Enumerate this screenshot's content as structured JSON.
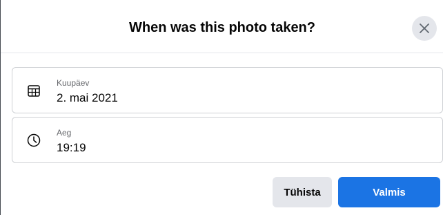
{
  "dialog": {
    "title": "When was this photo taken?",
    "close_icon": "close-icon"
  },
  "fields": {
    "date": {
      "label": "Kuupäev",
      "value": "2. mai 2021",
      "icon": "calendar-icon"
    },
    "time": {
      "label": "Aeg",
      "value": "19:19",
      "icon": "clock-icon"
    }
  },
  "actions": {
    "cancel_label": "Tühista",
    "done_label": "Valmis"
  },
  "colors": {
    "accent": "#1b74e4",
    "secondary_button": "#e4e6eb",
    "border": "#ced0d4",
    "text_primary": "#050505",
    "text_secondary": "#65676b"
  }
}
